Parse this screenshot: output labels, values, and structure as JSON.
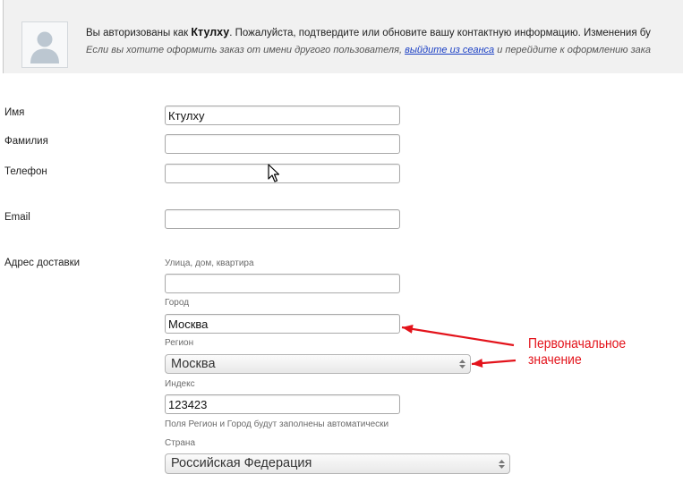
{
  "banner": {
    "line1_prefix": "Вы авторизованы как ",
    "username": "Ктулху",
    "line1_suffix": ". Пожалуйста, подтвердите или обновите вашу контактную информацию. Изменения бу",
    "line2_prefix": "Если вы хотите оформить заказ от имени другого пользователя, ",
    "logout_link": "выйдите из сеанса",
    "line2_suffix": " и перейдите к оформлению зака"
  },
  "form": {
    "name": {
      "label": "Имя",
      "value": "Ктулху"
    },
    "surname": {
      "label": "Фамилия",
      "value": ""
    },
    "phone": {
      "label": "Телефон",
      "value": ""
    },
    "email": {
      "label": "Email",
      "value": ""
    },
    "address": {
      "label": "Адрес доставки",
      "street": {
        "label": "Улица, дом, квартира",
        "value": ""
      },
      "city": {
        "label": "Город",
        "value": "Москва"
      },
      "region": {
        "label": "Регион",
        "value": "Москва"
      },
      "zip": {
        "label": "Индекс",
        "value": "123423"
      },
      "note": "Поля Регион и Город будут заполнены автоматически",
      "country": {
        "label": "Страна",
        "value": "Российская Федерация"
      }
    }
  },
  "annotation": {
    "line1": "Первоначальное",
    "line2": "значение"
  },
  "icons": {
    "avatar": "user-silhouette-icon",
    "select_arrows": "up-down-arrows-icon",
    "cursor": "mouse-pointer-icon",
    "annotation_arrows": "red-arrow-icon"
  },
  "colors": {
    "annotation": "#e3131b",
    "link": "#1a3fc4",
    "banner_background": "#f1f1f1"
  }
}
